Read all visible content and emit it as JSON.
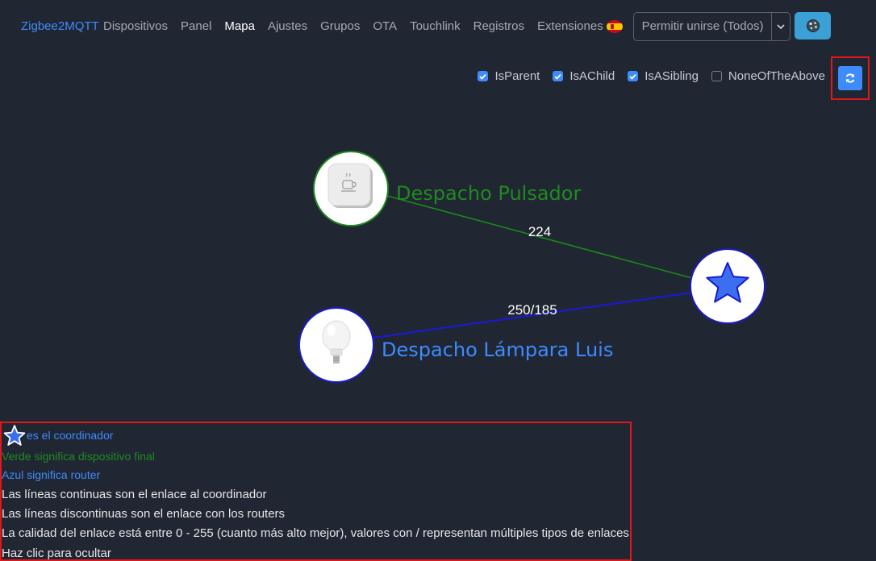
{
  "nav": {
    "brand": "Zigbee2MQTT",
    "links": [
      {
        "label": "Dispositivos",
        "active": false
      },
      {
        "label": "Panel",
        "active": false
      },
      {
        "label": "Mapa",
        "active": true
      },
      {
        "label": "Ajustes",
        "active": false
      },
      {
        "label": "Grupos",
        "active": false
      },
      {
        "label": "OTA",
        "active": false
      },
      {
        "label": "Touchlink",
        "active": false
      },
      {
        "label": "Registros",
        "active": false
      },
      {
        "label": "Extensiones",
        "active": false
      }
    ],
    "language_icon": "spain-flag-icon",
    "permit_join_label": "Permitir unirse (Todos)",
    "theme_icon": "theme-toggle-icon"
  },
  "filters": [
    {
      "label": "IsParent",
      "checked": true
    },
    {
      "label": "IsAChild",
      "checked": true
    },
    {
      "label": "IsASibling",
      "checked": true
    },
    {
      "label": "NoneOfTheAbove",
      "checked": false
    }
  ],
  "refresh_icon": "refresh-icon",
  "map": {
    "nodes": [
      {
        "id": "pulsador",
        "label": "Despacho Pulsador",
        "type": "EndDevice",
        "color": "#1f8a1f",
        "icon": "button-device-icon"
      },
      {
        "id": "lampara",
        "label": "Despacho Lámpara Luis",
        "type": "Router",
        "color": "#3d8bfd",
        "icon": "lightbulb-icon"
      },
      {
        "id": "coordinator",
        "label": "",
        "type": "Coordinator",
        "color": "#2a5fe6",
        "icon": "star-icon"
      }
    ],
    "links": [
      {
        "source": "pulsador",
        "target": "coordinator",
        "label": "224",
        "color": "#1a8a1a"
      },
      {
        "source": "lampara",
        "target": "coordinator",
        "label": "250/185",
        "color": "#1a1acc"
      }
    ]
  },
  "legend": {
    "coordinator": "es el coordinador",
    "green": "Verde significa dispositivo final",
    "blue": "Azul significa router",
    "solid": "Las líneas continuas son el enlace al coordinador",
    "dashed": "Las líneas discontinuas son el enlace con los routers",
    "quality": "La calidad del enlace está entre 0 - 255 (cuanto más alto mejor), valores con / representan múltiples tipos de enlaces",
    "hide": "Haz clic para ocultar"
  },
  "colors": {
    "background": "#212633",
    "accent": "#3d8bfd",
    "end_device": "#1f8a1f",
    "router_link": "#1a1acc",
    "highlight": "#e0181b"
  }
}
